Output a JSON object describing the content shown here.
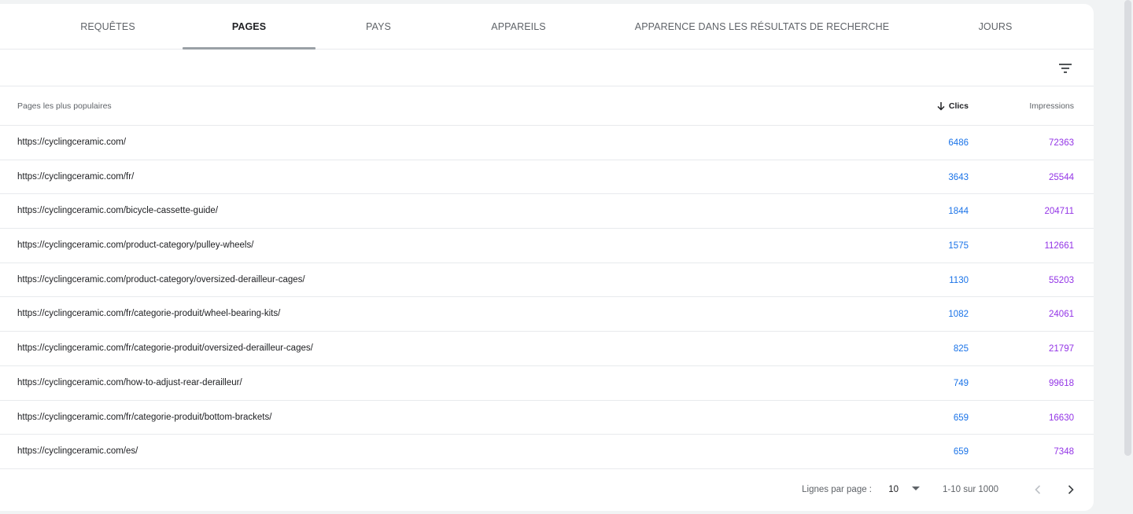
{
  "tabs": [
    {
      "label": "REQUÊTES",
      "active": false
    },
    {
      "label": "PAGES",
      "active": true
    },
    {
      "label": "PAYS",
      "active": false
    },
    {
      "label": "APPAREILS",
      "active": false
    },
    {
      "label": "APPARENCE DANS LES RÉSULTATS DE RECHERCHE",
      "active": false
    },
    {
      "label": "JOURS",
      "active": false
    }
  ],
  "filter_icon": "filter-list-icon",
  "table": {
    "columns": {
      "pages": "Pages les plus populaires",
      "clics": "Clics",
      "impressions": "Impressions"
    },
    "sort_icon": "arrow-down-icon",
    "rows": [
      {
        "url": "https://cyclingceramic.com/",
        "clics": "6486",
        "impressions": "72363"
      },
      {
        "url": "https://cyclingceramic.com/fr/",
        "clics": "3643",
        "impressions": "25544"
      },
      {
        "url": "https://cyclingceramic.com/bicycle-cassette-guide/",
        "clics": "1844",
        "impressions": "204711"
      },
      {
        "url": "https://cyclingceramic.com/product-category/pulley-wheels/",
        "clics": "1575",
        "impressions": "112661"
      },
      {
        "url": "https://cyclingceramic.com/product-category/oversized-derailleur-cages/",
        "clics": "1130",
        "impressions": "55203"
      },
      {
        "url": "https://cyclingceramic.com/fr/categorie-produit/wheel-bearing-kits/",
        "clics": "1082",
        "impressions": "24061"
      },
      {
        "url": "https://cyclingceramic.com/fr/categorie-produit/oversized-derailleur-cages/",
        "clics": "825",
        "impressions": "21797"
      },
      {
        "url": "https://cyclingceramic.com/how-to-adjust-rear-derailleur/",
        "clics": "749",
        "impressions": "99618"
      },
      {
        "url": "https://cyclingceramic.com/fr/categorie-produit/bottom-brackets/",
        "clics": "659",
        "impressions": "16630"
      },
      {
        "url": "https://cyclingceramic.com/es/",
        "clics": "659",
        "impressions": "7348"
      }
    ]
  },
  "pagination": {
    "rows_per_page_label": "Lignes par page :",
    "rows_per_page_value": "10",
    "range": "1-10 sur 1000",
    "prev_icon": "chevron-left-icon",
    "next_icon": "chevron-right-icon"
  },
  "colors": {
    "clics": "#1a73e8",
    "impressions": "#9334e6"
  }
}
